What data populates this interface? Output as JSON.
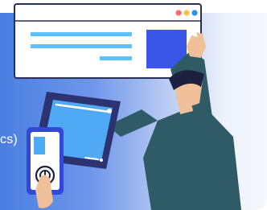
{
  "caption": {
    "text": "cs)"
  },
  "window": {
    "dots": [
      "#ff6b6b",
      "#ffc04d",
      "#2f8df5"
    ],
    "accent_tile": "#3a56e6",
    "text_lines": "#5ec0ff"
  },
  "colors": {
    "gradient_start": "#4a7fe0",
    "gradient_end": "#f6f8fd",
    "tablet_frame": "#2b3470",
    "phone_frame": "#3248d6",
    "person_jacket": "#2e5b66",
    "person_skin": "#f0c09a",
    "person_hair": "#1d2140"
  },
  "icons": [
    "browser-window-icon",
    "tablet-icon",
    "phone-icon",
    "fingerprint-icon",
    "person-illustration"
  ]
}
